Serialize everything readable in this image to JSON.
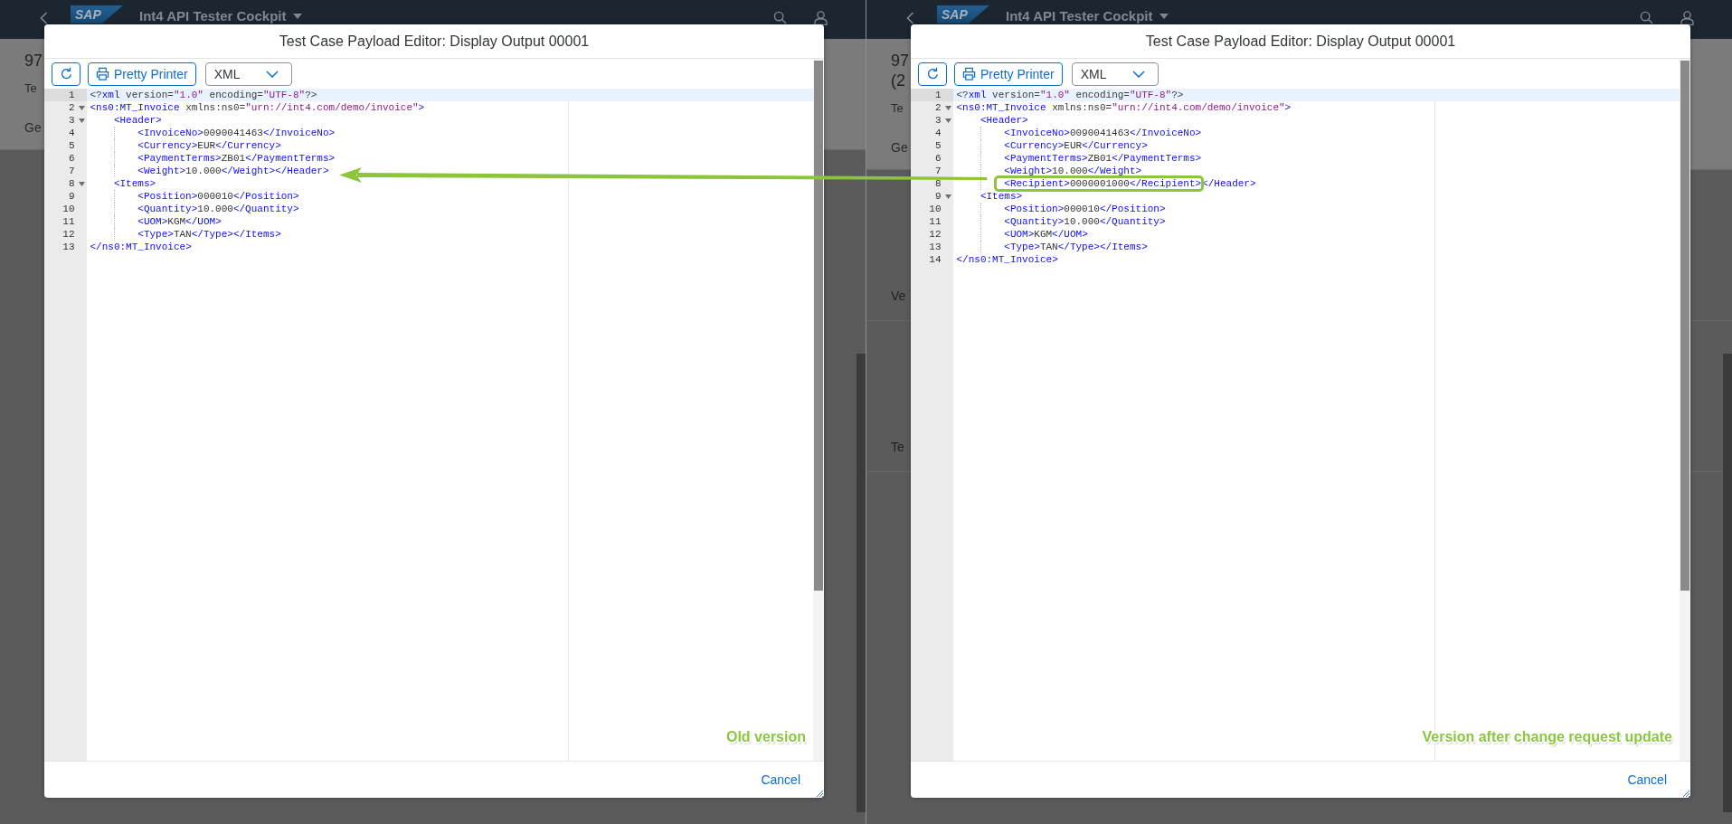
{
  "screens": [
    {
      "shell": {
        "logo": "SAP",
        "title": "Int4 API Tester Cockpit"
      },
      "background": {
        "title_lines": [
          "97"
        ],
        "subtitle": "Te",
        "tab": "Ge"
      },
      "dialog": {
        "title": "Test Case Payload Editor: Display Output 00001",
        "toolbar": {
          "pretty_printer_button": "Pretty Printer",
          "format_select": "XML"
        },
        "code_lines": [
          {
            "number": "1",
            "text": "<?xml version=\"1.0\" encoding=\"UTF-8\"?>",
            "active": true
          },
          {
            "number": "2",
            "text": "<ns0:MT_Invoice xmlns:ns0=\"urn://int4.com/demo/invoice\">",
            "active": false,
            "expanded": true,
            "children": [
              {
                "number": "3",
                "text": "<Header>",
                "active": false,
                "expanded": true,
                "children": [
                  {
                    "number": "4",
                    "text": "<InvoiceNo>0090041463</InvoiceNo>",
                    "active": false
                  },
                  {
                    "number": "5",
                    "text": "<Currency>EUR</Currency>",
                    "active": false
                  },
                  {
                    "number": "6",
                    "text": "<PaymentTerms>ZB01</PaymentTerms>",
                    "active": false
                  },
                  {
                    "number": "7",
                    "text": "<Weight>10.000</Weight></Header>",
                    "active": false
                  }
                ]
              },
              {
                "number": "8",
                "text": "<Items>",
                "active": false,
                "expanded": true,
                "children": [
                  {
                    "number": "9",
                    "text": "<Position>000010</Position>",
                    "active": false
                  },
                  {
                    "number": "10",
                    "text": "<Quantity>10.000</Quantity>",
                    "active": false
                  },
                  {
                    "number": "11",
                    "text": "<UOM>KGM</UOM>",
                    "active": false
                  },
                  {
                    "number": "12",
                    "text": "<Type>TAN</Type></Items>",
                    "active": false
                  }
                ]
              }
            ]
          },
          {
            "number": "13",
            "text": "</ns0:MT_Invoice>",
            "active": false
          }
        ],
        "caption": "Old version",
        "footer": {
          "cancel_button": "Cancel"
        }
      }
    },
    {
      "shell": {
        "logo": "SAP",
        "title": "Int4 API Tester Cockpit"
      },
      "background": {
        "title_lines": [
          "97",
          "(2"
        ],
        "subtitle": "Te",
        "tab": "Ge",
        "sections": [
          "Ve",
          "Te"
        ]
      },
      "dialog": {
        "title": "Test Case Payload Editor: Display Output 00001",
        "toolbar": {
          "pretty_printer_button": "Pretty Printer",
          "format_select": "XML"
        },
        "code_lines": [
          {
            "number": "1",
            "text": "<?xml version=\"1.0\" encoding=\"UTF-8\"?>",
            "active": true
          },
          {
            "number": "2",
            "text": "<ns0:MT_Invoice xmlns:ns0=\"urn://int4.com/demo/invoice\">",
            "active": false,
            "expanded": true,
            "children": [
              {
                "number": "3",
                "text": "<Header>",
                "active": false,
                "expanded": true,
                "children": [
                  {
                    "number": "4",
                    "text": "<InvoiceNo>0090041463</InvoiceNo>",
                    "active": false
                  },
                  {
                    "number": "5",
                    "text": "<Currency>EUR</Currency>",
                    "active": false
                  },
                  {
                    "number": "6",
                    "text": "<PaymentTerms>ZB01</PaymentTerms>",
                    "active": false
                  },
                  {
                    "number": "7",
                    "text": "<Weight>10.000</Weight>",
                    "active": false
                  },
                  {
                    "number": "8",
                    "boxed_text": "<Recipient>0000001000</Recipient>",
                    "text": "</Header>",
                    "active": false
                  }
                ]
              },
              {
                "number": "9",
                "text": "<Items>",
                "active": false,
                "expanded": true,
                "children": [
                  {
                    "number": "10",
                    "text": "<Position>000010</Position>",
                    "active": false
                  },
                  {
                    "number": "11",
                    "text": "<Quantity>10.000</Quantity>",
                    "active": false
                  },
                  {
                    "number": "12",
                    "text": "<UOM>KGM</UOM>",
                    "active": false
                  },
                  {
                    "number": "13",
                    "text": "<Type>TAN</Type></Items>",
                    "active": false
                  }
                ]
              }
            ]
          },
          {
            "number": "14",
            "text": "</ns0:MT_Invoice>",
            "active": false
          }
        ],
        "caption": "Version after change request update",
        "footer": {
          "cancel_button": "Cancel"
        }
      }
    }
  ]
}
